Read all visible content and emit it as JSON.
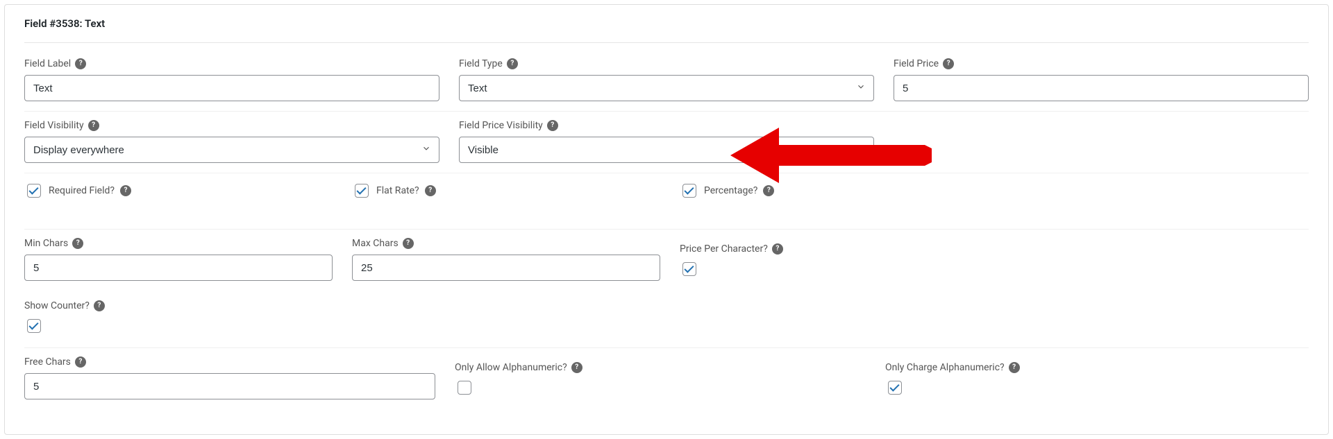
{
  "panel": {
    "title": "Field #3538: Text"
  },
  "fields": {
    "field_label": {
      "label": "Field Label",
      "value": "Text"
    },
    "field_type": {
      "label": "Field Type",
      "value": "Text"
    },
    "field_price": {
      "label": "Field Price",
      "value": "5"
    },
    "field_visibility": {
      "label": "Field Visibility",
      "value": "Display everywhere"
    },
    "field_price_visibility": {
      "label": "Field Price Visibility",
      "value": "Visible"
    },
    "required_field": {
      "label": "Required Field?",
      "checked": true
    },
    "flat_rate": {
      "label": "Flat Rate?",
      "checked": true
    },
    "percentage": {
      "label": "Percentage?",
      "checked": true
    },
    "min_chars": {
      "label": "Min Chars",
      "value": "5"
    },
    "max_chars": {
      "label": "Max Chars",
      "value": "25"
    },
    "price_per_char": {
      "label": "Price Per Character?",
      "checked": true
    },
    "show_counter": {
      "label": "Show Counter?",
      "checked": true
    },
    "free_chars": {
      "label": "Free Chars",
      "value": "5"
    },
    "only_allow_alpha": {
      "label": "Only Allow Alphanumeric?",
      "checked": false
    },
    "only_charge_alpha": {
      "label": "Only Charge Alphanumeric?",
      "checked": true
    }
  },
  "annotation": {
    "arrow_color": "#e60000"
  }
}
